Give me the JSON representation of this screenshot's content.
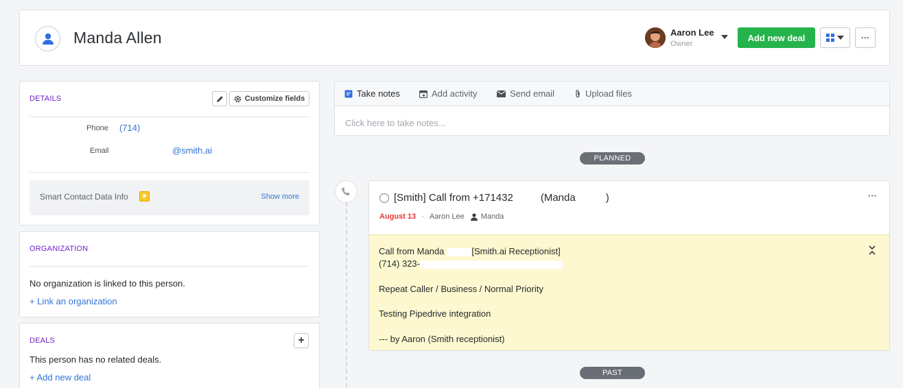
{
  "header": {
    "person_name": "Manda Allen",
    "owner_name": "Aaron Lee",
    "owner_role": "Owner",
    "add_deal_label": "Add new deal",
    "more_label": "···"
  },
  "details": {
    "title": "DETAILS",
    "customize_label": "Customize fields",
    "phone_label": "Phone",
    "phone_value": "(714)",
    "email_label": "Email",
    "email_value": "@smith.ai",
    "smart_label": "Smart Contact Data Info",
    "show_more": "Show more"
  },
  "organization": {
    "title": "ORGANIZATION",
    "empty_text": "No organization is linked to this person.",
    "link_label": "+ Link an organization"
  },
  "deals": {
    "title": "DEALS",
    "empty_text": "This person has no related deals.",
    "add_label": "+ Add new deal"
  },
  "notes": {
    "tabs": [
      {
        "label": "Take notes",
        "icon": "notes-icon"
      },
      {
        "label": "Add activity",
        "icon": "calendar-icon"
      },
      {
        "label": "Send email",
        "icon": "envelope-icon"
      },
      {
        "label": "Upload files",
        "icon": "paperclip-icon"
      }
    ],
    "placeholder": "Click here to take notes..."
  },
  "timeline": {
    "planned_label": "PLANNED",
    "past_label": "PAST"
  },
  "activity": {
    "title_prefix": "[Smith] Call from +171432",
    "title_suffix": "(Manda",
    "title_end": ")",
    "date": "August 13",
    "owner": "Aaron Lee",
    "participant": "Manda",
    "more_label": "···",
    "note_lines": [
      "Call from Manda",
      "[Smith.ai Receptionist]",
      "(714) 323-",
      "Repeat Caller / Business / Normal Priority",
      "Testing Pipedrive integration",
      "--- by Aaron (Smith receptionist)"
    ]
  },
  "colors": {
    "accent_green": "#25b34b",
    "section_purple": "#6f1fc9",
    "link_blue": "#3174d6",
    "date_red": "#e53935",
    "note_yellow": "#fdf8cf"
  }
}
